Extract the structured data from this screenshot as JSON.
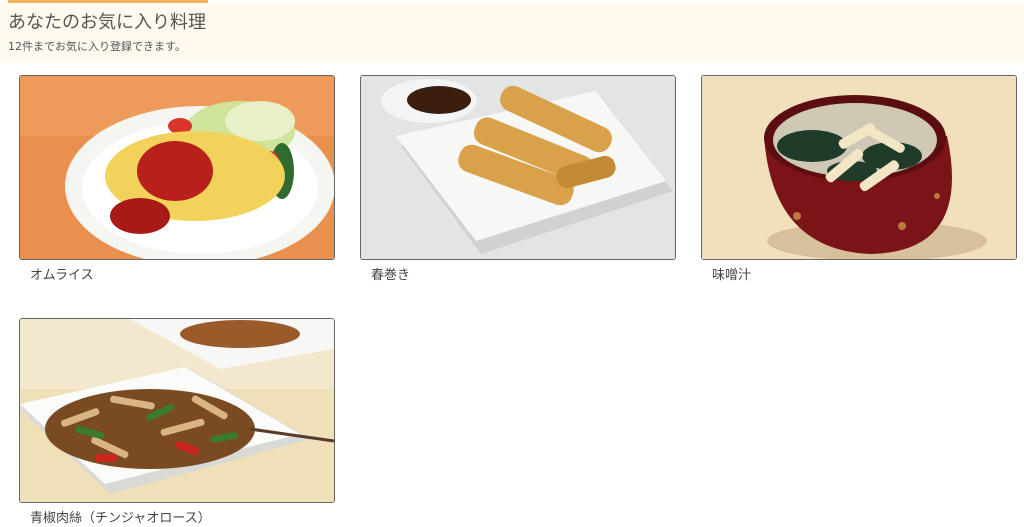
{
  "header": {
    "title": "あなたのお気に入り料理",
    "subtitle": "12件までお気に入り登録できます。"
  },
  "colors": {
    "accent": "#f0b25c",
    "header_bg": "#fff9f0"
  },
  "favorites": [
    {
      "name": "オムライス"
    },
    {
      "name": "春巻き"
    },
    {
      "name": "味噌汁"
    },
    {
      "name": "青椒肉絲（チンジャオロース）"
    }
  ]
}
